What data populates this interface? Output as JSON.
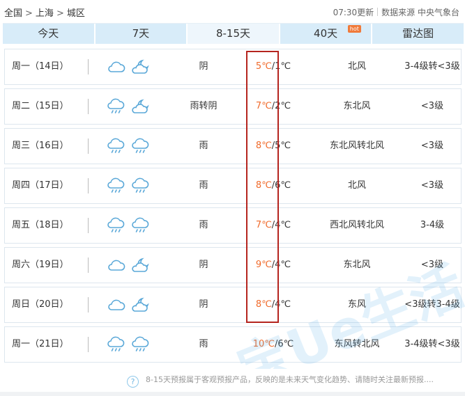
{
  "breadcrumb": {
    "country": "全国",
    "city": "上海",
    "district": "城区",
    "separator": ">"
  },
  "meta": {
    "update_time": "07:30更新",
    "source": "数据来源 中央气象台"
  },
  "tabs": [
    {
      "label": "今天",
      "active": false
    },
    {
      "label": "7天",
      "active": false
    },
    {
      "label": "8-15天",
      "active": true
    },
    {
      "label": "40天",
      "active": false,
      "badge": "hot"
    },
    {
      "label": "雷达图",
      "active": false
    }
  ],
  "forecast": [
    {
      "day": "周一（14日）",
      "icons": [
        "cloudy-icon",
        "partly-cloudy-night-icon"
      ],
      "condition": "阴",
      "high": "5℃",
      "low": "/1℃",
      "wind_dir": "北风",
      "wind_level": "3-4级转<3级"
    },
    {
      "day": "周二（15日）",
      "icons": [
        "rain-icon",
        "partly-cloudy-night-icon"
      ],
      "condition": "雨转阴",
      "high": "7℃",
      "low": "/2℃",
      "wind_dir": "东北风",
      "wind_level": "<3级"
    },
    {
      "day": "周三（16日）",
      "icons": [
        "rain-icon",
        "rain-icon"
      ],
      "condition": "雨",
      "high": "8℃",
      "low": "/5℃",
      "wind_dir": "东北风转北风",
      "wind_level": "<3级"
    },
    {
      "day": "周四（17日）",
      "icons": [
        "rain-icon",
        "rain-icon"
      ],
      "condition": "雨",
      "high": "8℃",
      "low": "/6℃",
      "wind_dir": "北风",
      "wind_level": "<3级"
    },
    {
      "day": "周五（18日）",
      "icons": [
        "rain-icon",
        "rain-icon"
      ],
      "condition": "雨",
      "high": "7℃",
      "low": "/4℃",
      "wind_dir": "西北风转北风",
      "wind_level": "3-4级"
    },
    {
      "day": "周六（19日）",
      "icons": [
        "cloudy-icon",
        "partly-cloudy-night-icon"
      ],
      "condition": "阴",
      "high": "9℃",
      "low": "/4℃",
      "wind_dir": "东北风",
      "wind_level": "<3级"
    },
    {
      "day": "周日（20日）",
      "icons": [
        "cloudy-icon",
        "partly-cloudy-night-icon"
      ],
      "condition": "阴",
      "high": "8℃",
      "low": "/4℃",
      "wind_dir": "东风",
      "wind_level": "<3级转3-4级"
    },
    {
      "day": "周一（21日）",
      "icons": [
        "rain-icon",
        "rain-icon"
      ],
      "condition": "雨",
      "high": "10℃",
      "low": "/6℃",
      "wind_dir": "东风转北风",
      "wind_level": "3-4级转<3级"
    }
  ],
  "footer": {
    "help_icon": "?",
    "note": "8-15天预报属于客观预报产品，反映的是未来天气变化趋势、请随时关注最新预报...."
  },
  "watermark": {
    "text": "宝Ue生活"
  },
  "colors": {
    "tab_bg": "#d8ecf9",
    "temp_high": "#f06a2a",
    "highlight_border": "#b5241e",
    "icon_stroke": "#5aa8d8"
  }
}
